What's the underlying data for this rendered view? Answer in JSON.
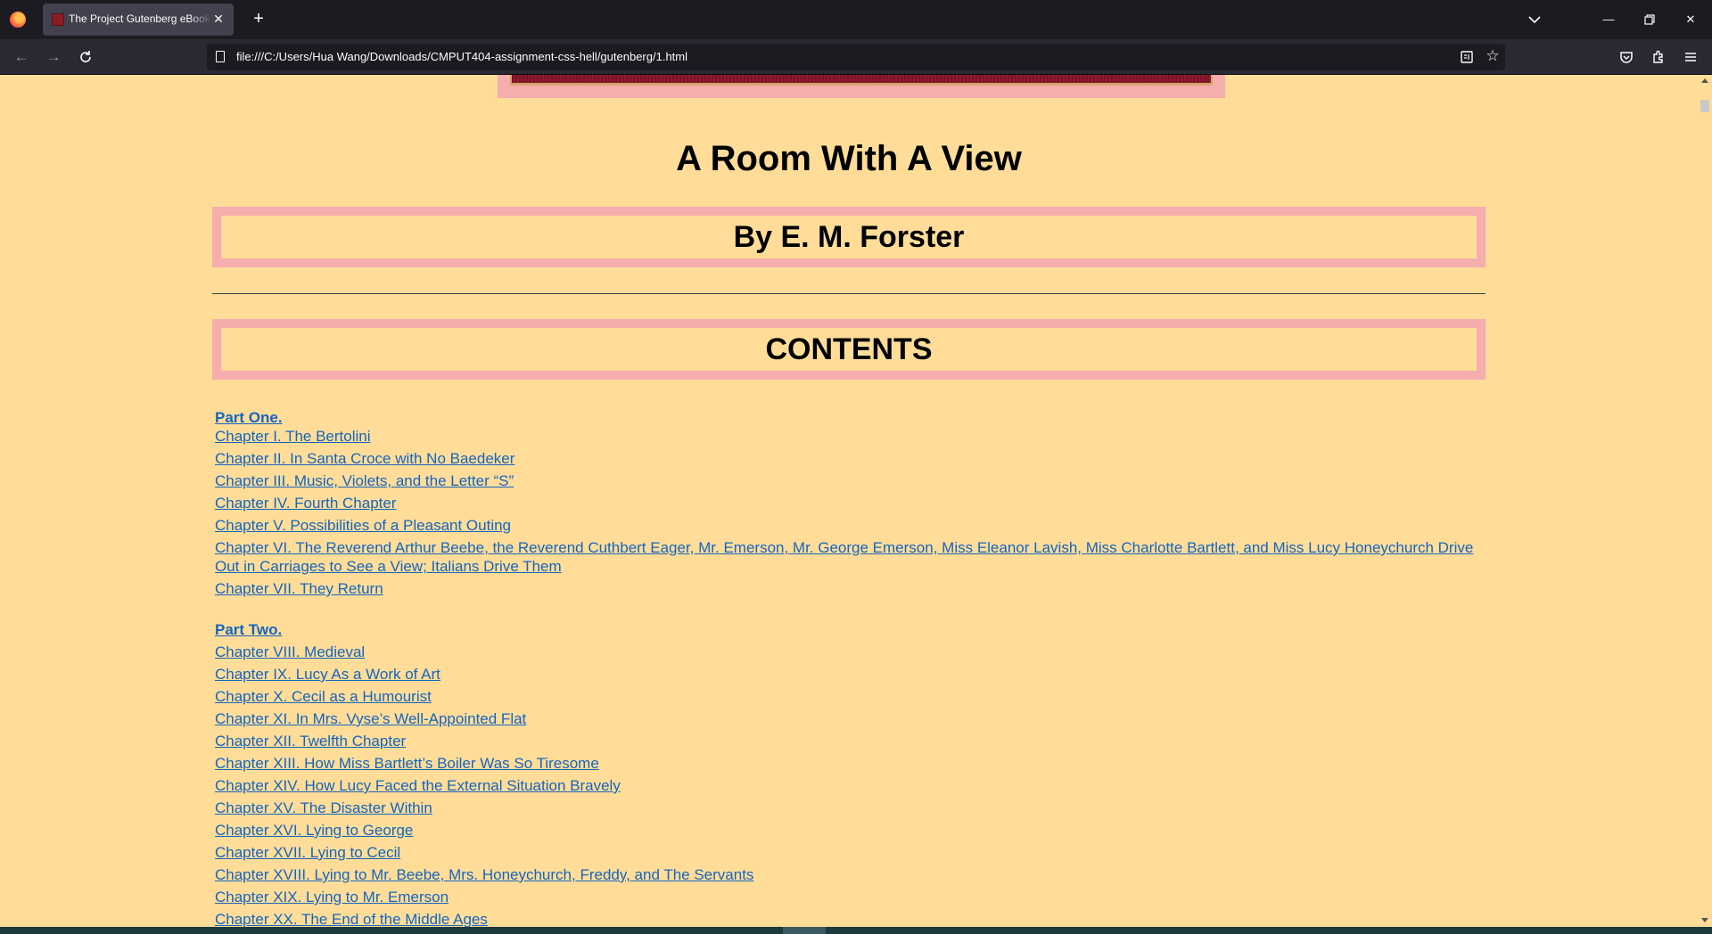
{
  "browser": {
    "tab_title": "The Project Gutenberg eBook of A Room With A View, by E. M. Forster",
    "url": "file:///C:/Users/Hua Wang/Downloads/CMPUT404-assignment-css-hell/gutenberg/1.html",
    "icons": {
      "app": "firefox-icon",
      "favicon": "book-favicon-icon",
      "close": "close-icon",
      "new_tab": "plus-icon",
      "list_tabs": "chevron-down-icon",
      "back": "arrow-left-icon",
      "forward": "arrow-right-icon",
      "reload": "reload-icon",
      "reader": "reader-view-icon",
      "bookmark": "star-icon",
      "pocket": "pocket-icon",
      "extensions": "puzzle-icon",
      "menu": "hamburger-icon"
    },
    "colors": {
      "chrome_dark": "#1c1b22",
      "toolbar": "#2b2a33",
      "tab_active": "#42414d"
    }
  },
  "page": {
    "title": "A Room With A View",
    "author": "By E. M. Forster",
    "contents_heading": "CONTENTS",
    "colors": {
      "background": "#ffdd99",
      "box_border": "#f5adad",
      "link": "#1565c0"
    },
    "part_one": {
      "label": "Part One.",
      "chapters": [
        "Chapter I. The Bertolini",
        "Chapter II. In Santa Croce with No Baedeker",
        "Chapter III. Music, Violets, and the Letter “S”",
        "Chapter IV. Fourth Chapter",
        "Chapter V. Possibilities of a Pleasant Outing",
        "Chapter VI. The Reverend Arthur Beebe, the Reverend Cuthbert Eager, Mr. Emerson, Mr. George Emerson, Miss Eleanor Lavish, Miss Charlotte Bartlett, and Miss Lucy Honeychurch Drive Out in Carriages to See a View; Italians Drive Them",
        "Chapter VII. They Return"
      ]
    },
    "part_two": {
      "label": "Part Two.",
      "chapters": [
        "Chapter VIII. Medieval",
        "Chapter IX. Lucy As a Work of Art",
        "Chapter X. Cecil as a Humourist",
        "Chapter XI. In Mrs. Vyse’s Well-Appointed Flat",
        "Chapter XII. Twelfth Chapter",
        "Chapter XIII. How Miss Bartlett’s Boiler Was So Tiresome",
        "Chapter XIV. How Lucy Faced the External Situation Bravely",
        "Chapter XV. The Disaster Within",
        "Chapter XVI. Lying to George",
        "Chapter XVII. Lying to Cecil",
        "Chapter XVIII. Lying to Mr. Beebe, Mrs. Honeychurch, Freddy, and The Servants",
        "Chapter XIX. Lying to Mr. Emerson",
        "Chapter XX. The End of the Middle Ages"
      ]
    }
  }
}
